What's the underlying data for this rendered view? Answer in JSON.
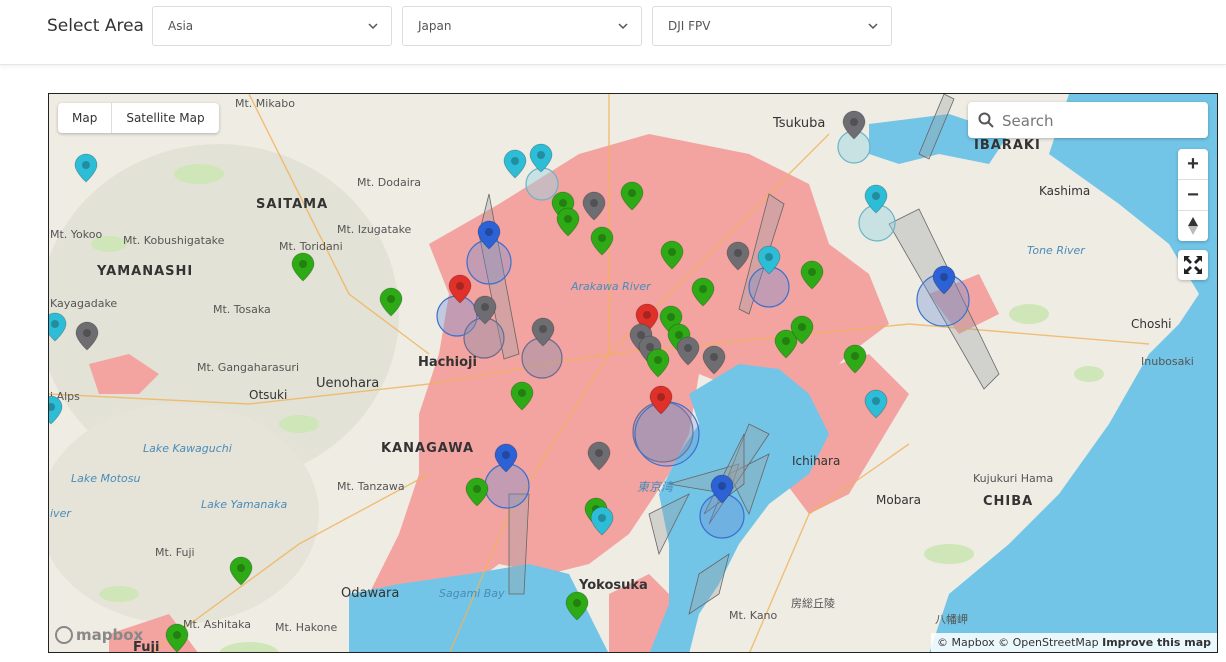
{
  "header": {
    "label": "Select Area",
    "region": "Asia",
    "country": "Japan",
    "drone": "DJI FPV"
  },
  "map": {
    "type_buttons": [
      "Map",
      "Satellite Map"
    ],
    "search_placeholder": "Search",
    "zoom_in": "+",
    "zoom_out": "−",
    "attribution": "© Mapbox © OpenStreetMap",
    "improve": "Improve this map",
    "logo": "mapbox",
    "labels": {
      "tsukuba": "Tsukuba",
      "ibaraki": "IBARAKI",
      "kashima": "Kashima",
      "tone_river": "Tone River",
      "saitama": "SAITAMA",
      "mt_mikabo": "Mt. Mikabo",
      "mt_dodaira": "Mt. Dodaira",
      "mt_yokoo": "Mt. Yokoo",
      "mt_kobushigatake": "Mt. Kobushigatake",
      "mt_izugatake": "Mt. Izugatake",
      "mt_toridani": "Mt. Toridani",
      "yamanashi": "YAMANASHI",
      "kayagadake": "Kayagadake",
      "mt_tosaka": "Mt. Tosaka",
      "arakawa_river": "Arakawa River",
      "chosi": "Choshi",
      "inubosaki": "Inubosaki",
      "hachioji": "Hachioji",
      "uenohara": "Uenohara",
      "mt_gangaharasuri": "Mt. Gangaharasuri",
      "otsuki": "Otsuki",
      "alps": "i Alps",
      "kanagawa": "KANAGAWA",
      "lake_kawaguchi": "Lake Kawaguchi",
      "lake_motosu": "Lake Motosu",
      "mt_tanzawa": "Mt. Tanzawa",
      "lake_yamanaka": "Lake Yamanaka",
      "ichihara": "Ichihara",
      "kujukuri_hama": "Kujukuri Hama",
      "chiba": "CHIBA",
      "mobara": "Mobara",
      "tokyo_bay": "東京湾",
      "river_left": "iver",
      "mt_fuji": "Mt. Fuji",
      "yokosuka": "Yokosuka",
      "odawara": "Odawara",
      "sagami_bay": "Sagami Bay",
      "mt_ashitaka": "Mt. Ashitaka",
      "mt_hakone": "Mt. Hakone",
      "mt_kano": "Mt. Kano",
      "boso": "房総丘陵",
      "yawata": "八幡岬",
      "fuji_partial": "Fuji"
    },
    "pin_colors": {
      "green": "#2eaa16",
      "cyan": "#2ebdd6",
      "blue": "#2d62d6",
      "red": "#e0302a",
      "gray": "#6e6e72",
      "dark_green": "#4a7a12"
    }
  }
}
